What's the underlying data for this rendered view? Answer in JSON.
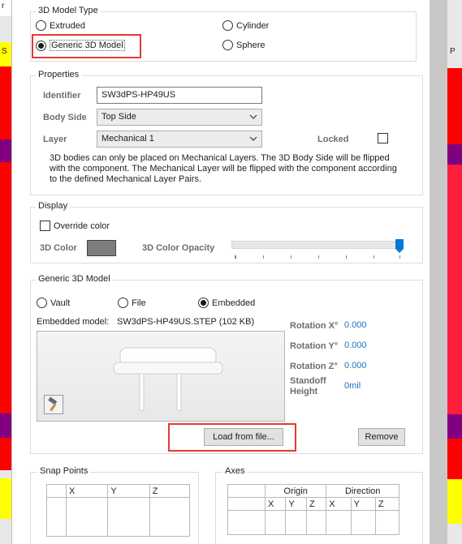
{
  "background": {
    "left_labels": [
      "r",
      "S"
    ],
    "right_labels": [
      "P"
    ]
  },
  "model_type": {
    "title": "3D Model Type",
    "options": [
      {
        "label": "Extruded",
        "checked": false
      },
      {
        "label": "Cylinder",
        "checked": false
      },
      {
        "label": "Generic 3D Model",
        "checked": true
      },
      {
        "label": "Sphere",
        "checked": false
      }
    ]
  },
  "properties": {
    "title": "Properties",
    "identifier_label": "Identifier",
    "identifier_value": "SW3dPS-HP49US",
    "body_side_label": "Body Side",
    "body_side_value": "Top Side",
    "layer_label": "Layer",
    "layer_value": "Mechanical 1",
    "locked_label": "Locked",
    "locked_checked": false,
    "note": "3D bodies can only be placed on Mechanical Layers. The 3D Body Side will be flipped with the component. The Mechanical Layer will be flipped with the component according to the defined Mechanical Layer Pairs."
  },
  "display": {
    "title": "Display",
    "override_label": "Override color",
    "override_checked": false,
    "color_label": "3D Color",
    "color_value": "#7d7d7d",
    "opacity_label": "3D Color Opacity",
    "opacity_fraction": 1.0
  },
  "generic_model": {
    "title": "Generic 3D Model",
    "sources": [
      {
        "label": "Vault",
        "checked": false
      },
      {
        "label": "File",
        "checked": false
      },
      {
        "label": "Embedded",
        "checked": true
      }
    ],
    "embedded_label": "Embedded model:",
    "embedded_value": "SW3dPS-HP49US.STEP (102 KB)",
    "rotation_x_label": "Rotation X°",
    "rotation_x_value": "0.000",
    "rotation_y_label": "Rotation Y°",
    "rotation_y_value": "0.000",
    "rotation_z_label": "Rotation Z°",
    "rotation_z_value": "0.000",
    "standoff_label_1": "Standoff",
    "standoff_label_2": "Height",
    "standoff_value": "0mil",
    "load_button": "Load from file...",
    "remove_button": "Remove"
  },
  "snap_points": {
    "title": "Snap Points",
    "columns": [
      "",
      "X",
      "Y",
      "Z"
    ]
  },
  "axes": {
    "title": "Axes",
    "group_headers": [
      "",
      "Origin",
      "Direction"
    ],
    "columns": [
      "",
      "X",
      "Y",
      "Z",
      "X",
      "Y",
      "Z"
    ]
  },
  "colors": {
    "highlight": "#e53935",
    "value_blue": "#1f6fc6",
    "stripe_red": "#ff0000",
    "stripe_yellow": "#ffff00",
    "stripe_purple": "#800080"
  }
}
